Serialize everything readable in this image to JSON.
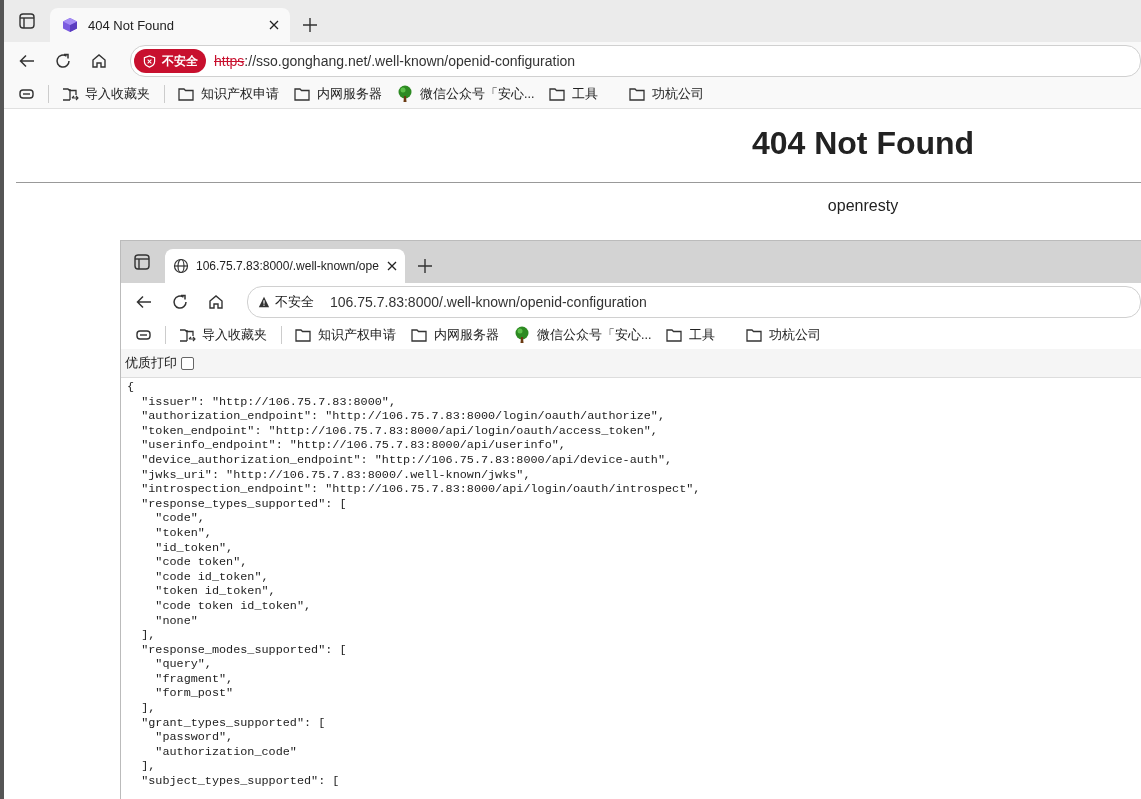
{
  "browser": {
    "tabs": [
      {
        "title": "404 Not Found",
        "kind": "cube",
        "selected": true
      }
    ],
    "address": {
      "security": {
        "label": "不安全",
        "kind": "danger"
      },
      "scheme": "https",
      "rest": "://sso.gonghang.net/.well-known/openid-configuration"
    },
    "bookmarks": [
      {
        "label": "导入收藏夹",
        "kind": "import"
      },
      {
        "label": "知识产权申请",
        "kind": "folder"
      },
      {
        "label": "内网服务器",
        "kind": "folder"
      },
      {
        "label": "微信公众号「安心...",
        "kind": "tree"
      },
      {
        "label": "工具",
        "kind": "folder"
      },
      {
        "label": "功杭公司",
        "kind": "folder"
      }
    ]
  },
  "page": {
    "heading": "404 Not Found",
    "server": "openresty"
  },
  "inner_browser": {
    "tabs": [
      {
        "title": "106.75.7.83:8000/.well-known/ope",
        "kind": "globe",
        "selected": true
      }
    ],
    "address": {
      "security": {
        "label": "不安全",
        "kind": "warning"
      },
      "url": "106.75.7.83:8000/.well-known/openid-configuration"
    },
    "bookmarks": [
      {
        "label": "导入收藏夹",
        "kind": "import"
      },
      {
        "label": "知识产权申请",
        "kind": "folder"
      },
      {
        "label": "内网服务器",
        "kind": "folder"
      },
      {
        "label": "微信公众号「安心...",
        "kind": "tree"
      },
      {
        "label": "工具",
        "kind": "folder"
      },
      {
        "label": "功杭公司",
        "kind": "folder"
      }
    ],
    "pretty_print": {
      "label": "优质打印",
      "checked": false
    },
    "json_lines": [
      "{",
      "  \"issuer\": \"http://106.75.7.83:8000\",",
      "  \"authorization_endpoint\": \"http://106.75.7.83:8000/login/oauth/authorize\",",
      "  \"token_endpoint\": \"http://106.75.7.83:8000/api/login/oauth/access_token\",",
      "  \"userinfo_endpoint\": \"http://106.75.7.83:8000/api/userinfo\",",
      "  \"device_authorization_endpoint\": \"http://106.75.7.83:8000/api/device-auth\",",
      "  \"jwks_uri\": \"http://106.75.7.83:8000/.well-known/jwks\",",
      "  \"introspection_endpoint\": \"http://106.75.7.83:8000/api/login/oauth/introspect\",",
      "  \"response_types_supported\": [",
      "    \"code\",",
      "    \"token\",",
      "    \"id_token\",",
      "    \"code token\",",
      "    \"code id_token\",",
      "    \"token id_token\",",
      "    \"code token id_token\",",
      "    \"none\"",
      "  ],",
      "  \"response_modes_supported\": [",
      "    \"query\",",
      "    \"fragment\",",
      "    \"form_post\"",
      "  ],",
      "  \"grant_types_supported\": [",
      "    \"password\",",
      "    \"authorization_code\"",
      "  ],",
      "  \"subject_types_supported\": ["
    ]
  }
}
